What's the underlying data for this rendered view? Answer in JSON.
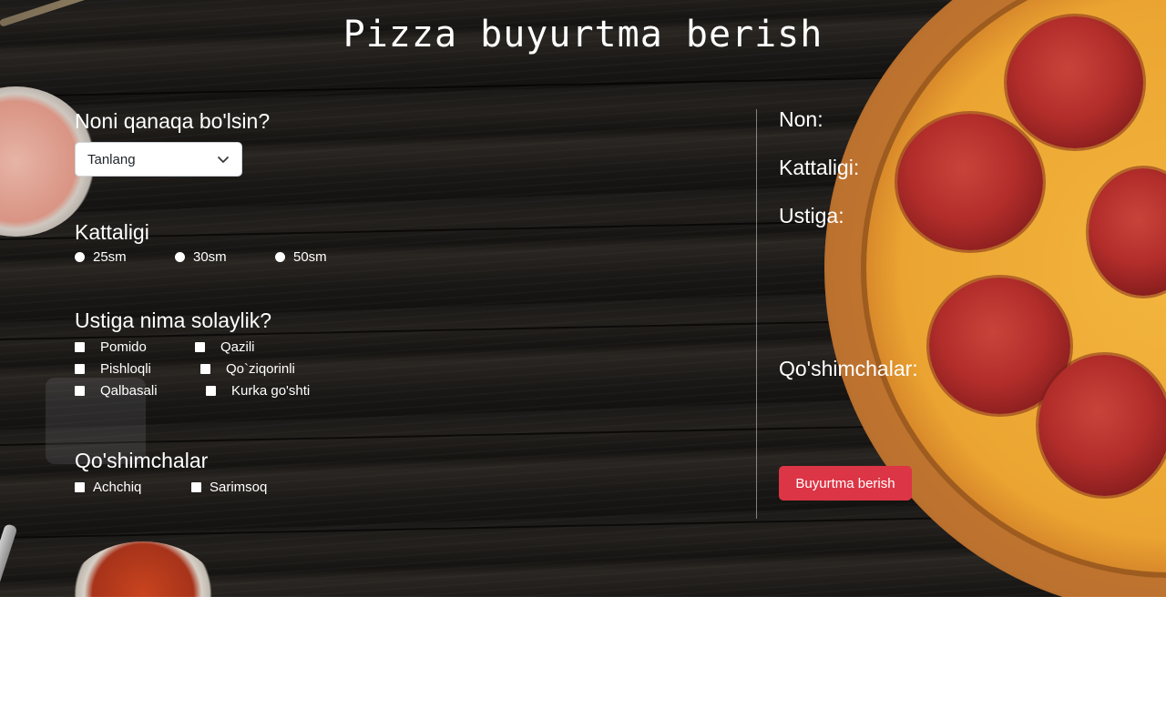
{
  "title": "Pizza buyurtma berish",
  "dough": {
    "heading": "Noni qanaqa bo'lsin?",
    "selected": "Tanlang"
  },
  "size": {
    "heading": "Kattaligi",
    "options": [
      "25sm",
      "30sm",
      "50sm"
    ]
  },
  "toppings": {
    "heading": "Ustiga nima solaylik?",
    "options": [
      "Pomido",
      "Qazili",
      "Pishloqli",
      "Qo`ziqorinli",
      "Qalbasali",
      "Kurka go'shti"
    ]
  },
  "extras": {
    "heading": "Qo'shimchalar",
    "options": [
      "Achchiq",
      "Sarimsoq"
    ]
  },
  "summary": {
    "bread_label": "Non:",
    "size_label": "Kattaligi:",
    "toppings_label": "Ustiga:",
    "extras_label": "Qo'shimchalar:"
  },
  "order_button": "Buyurtma berish",
  "colors": {
    "accent": "#dc3545",
    "text": "#ffffff",
    "background": "#1b1917"
  },
  "icons": {
    "select_chevron": "chevron-down-icon"
  }
}
